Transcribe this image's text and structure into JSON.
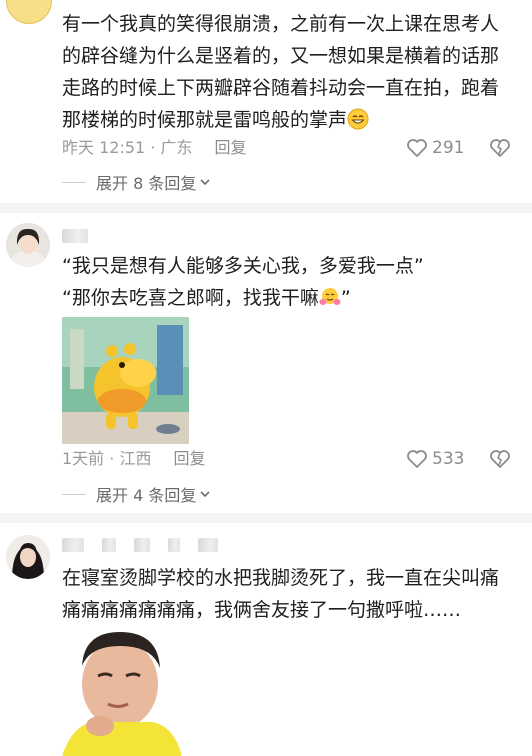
{
  "comments": [
    {
      "text": "有一个我真的笑得很崩溃，之前有一次上课在思考人的辟谷缝为什么是竖着的，又一想如果是横着的话那走路的时候上下两瓣辟谷随着抖动会一直在拍，跑着那楼梯的时候那就是雷鸣般的掌声",
      "emoji": "grinning-face-emoji",
      "time": "昨天 12:51",
      "location": "广东",
      "reply_label": "回复",
      "likes": "291",
      "expand": "展开 8 条回复"
    },
    {
      "line1": "“我只是想有人能够多关心我，多爱我一点”",
      "line2": "“那你去吃喜之郎啊，找我干嘛",
      "line2_end": "”",
      "emoji": "hugging-face-emoji",
      "time": "1天前",
      "location": "江西",
      "reply_label": "回复",
      "likes": "533",
      "expand": "展开 4 条回复"
    },
    {
      "text": "在寝室烫脚学校的水把我脚烫死了，我一直在尖叫痛痛痛痛痛痛痛痛，我俩舍友接了一句撒呼啦……"
    }
  ],
  "colors": {
    "text": "#1f1f1f",
    "meta": "#9a9a9a",
    "divider": "#f4f4f4"
  },
  "icons": [
    "heart-icon",
    "dislike-heart-icon",
    "chevron-down-icon"
  ]
}
